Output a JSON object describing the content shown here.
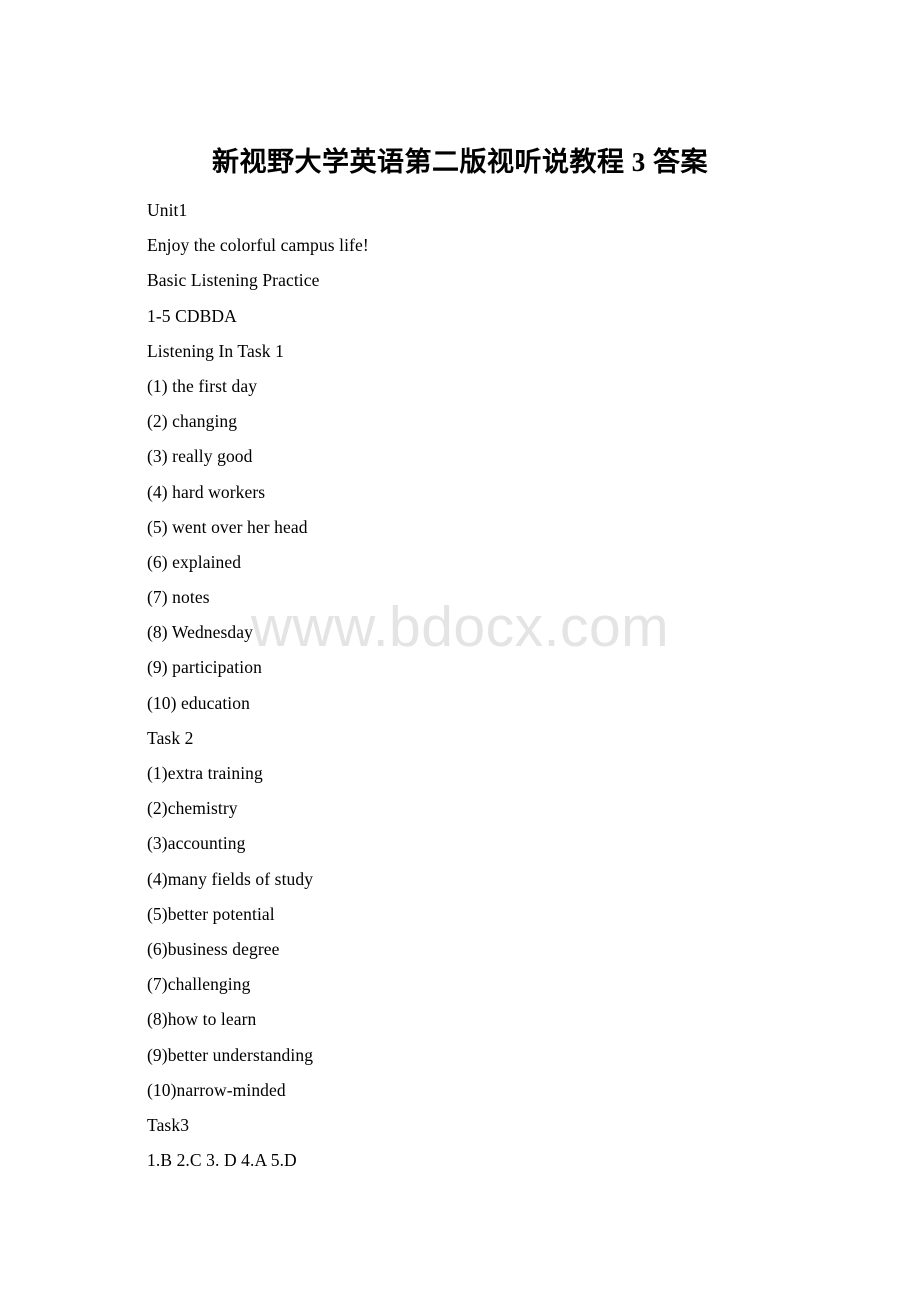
{
  "document": {
    "title": "新视野大学英语第二版视听说教程 3 答案",
    "watermark": "www.bdocx.com",
    "background_color": "#ffffff",
    "text_color": "#000000",
    "watermark_color": "#e4e4e4"
  },
  "lines": [
    {
      "text": "Unit1"
    },
    {
      "text": "Enjoy the colorful campus life!"
    },
    {
      "text": "Basic Listening Practice"
    },
    {
      "text": "1-5 CDBDA"
    },
    {
      "text": "Listening In Task 1"
    },
    {
      "text": "(1) the first day"
    },
    {
      "text": "(2) changing"
    },
    {
      "text": "(3) really good"
    },
    {
      "text": "(4) hard workers"
    },
    {
      "text": "(5) went over her head"
    },
    {
      "text": "(6) explained"
    },
    {
      "text": "(7) notes"
    },
    {
      "text": "(8) Wednesday"
    },
    {
      "text": "(9) participation"
    },
    {
      "text": "(10) education"
    },
    {
      "text": "Task 2"
    },
    {
      "text": "(1)extra training"
    },
    {
      "text": "(2)chemistry"
    },
    {
      "text": "(3)accounting"
    },
    {
      "text": "(4)many fields of study"
    },
    {
      "text": "(5)better potential"
    },
    {
      "text": "(6)business degree"
    },
    {
      "text": "(7)challenging"
    },
    {
      "text": "(8)how to learn"
    },
    {
      "text": "(9)better understanding"
    },
    {
      "text": "(10)narrow-minded"
    },
    {
      "text": "Task3"
    },
    {
      "text": "1.B 2.C 3. D 4.A 5.D"
    }
  ]
}
